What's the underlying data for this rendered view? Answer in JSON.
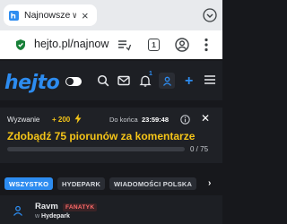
{
  "browser": {
    "tab_title": "Najnowsze wpisy - hejto.pl",
    "tab_close_glyph": "×",
    "url": "hejto.pl/najnowsze",
    "tab_count": "1",
    "icons": [
      "hejto-favicon",
      "chevron-down-icon",
      "lock-icon",
      "reader-mode-icon",
      "tab-switcher-icon",
      "account-icon",
      "more-vert-icon"
    ]
  },
  "site": {
    "logo": "hejto",
    "notification_count": "1",
    "plus_glyph": "+",
    "icons": [
      "theme-toggle-icon",
      "search-icon",
      "mail-icon",
      "bell-icon",
      "user-icon",
      "plus-icon",
      "menu-icon"
    ]
  },
  "challenge": {
    "label": "Wyzwanie",
    "points": "+ 200",
    "deadline_label": "Do końca",
    "deadline_time": "23:59:48",
    "title": "Zdobądź 75 piorunów za komentarze",
    "progress_text": "0 / 75",
    "progress_current": 0,
    "progress_total": 75,
    "close_glyph": "✕",
    "accent_color": "#f5c518"
  },
  "categories": {
    "items": [
      "WSZYSTKO",
      "HYDEPARK",
      "WIADOMOŚCI POLSKA"
    ],
    "active_index": 0,
    "next_glyph": "›"
  },
  "post": {
    "author": "Ravm",
    "rank": "FANATYK",
    "community_prefix": "w",
    "community": "Hydepark"
  },
  "colors": {
    "brand_blue": "#2d8cf0",
    "background": "#17181c",
    "rank_red": "#ff6b6b"
  }
}
